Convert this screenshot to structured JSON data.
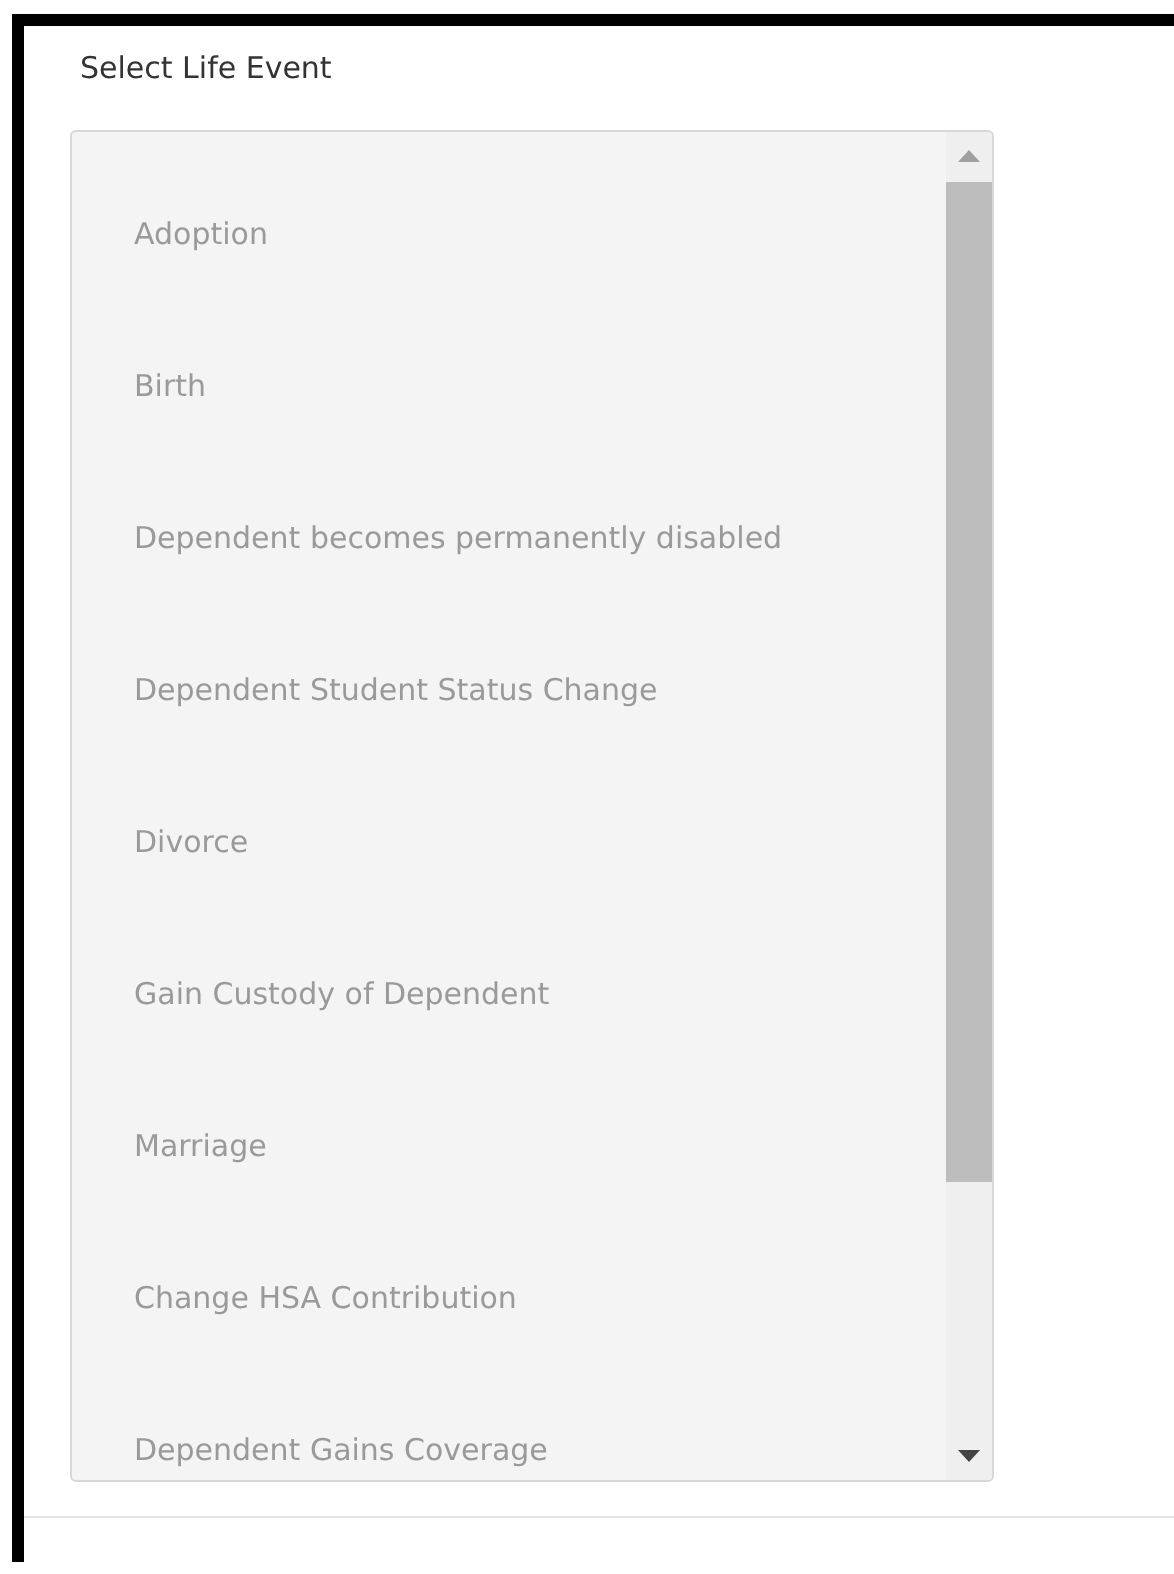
{
  "title": "Select Life Event",
  "events": [
    {
      "label": "Adoption",
      "selected": false
    },
    {
      "label": "Birth",
      "selected": false
    },
    {
      "label": "Dependent becomes permanently disabled",
      "selected": false
    },
    {
      "label": "Dependent Student Status Change",
      "selected": false
    },
    {
      "label": "Divorce",
      "selected": false
    },
    {
      "label": "Gain Custody of Dependent",
      "selected": false
    },
    {
      "label": "Marriage",
      "selected": false
    },
    {
      "label": "Change HSA Contribution",
      "selected": false
    },
    {
      "label": "Dependent Gains Coverage",
      "selected": false
    }
  ]
}
